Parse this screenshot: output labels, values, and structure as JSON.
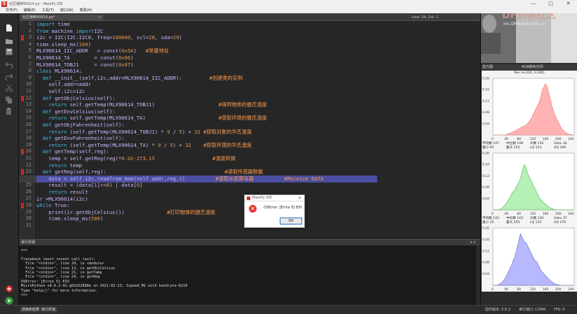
{
  "window": {
    "title": "社区播种90614.py - MaixPy IDE",
    "controls": [
      "—",
      "□",
      "✕"
    ]
  },
  "menu": [
    "文件(F)",
    "编辑(E)",
    "工具(T)",
    "窗口(W)",
    "帮助(H)"
  ],
  "editor_tab": {
    "name": "社区播种90614.py*",
    "info": "Line: 24, Col: 1"
  },
  "line_numbers": [
    "1",
    "2",
    "3",
    "4",
    "5",
    "6",
    "7",
    "8",
    "9",
    "10",
    "11",
    "12",
    "13",
    "14",
    "15",
    "16",
    "17",
    "18",
    "19",
    "20",
    "21",
    "22",
    "23",
    "24",
    "25",
    "26",
    "27",
    "28",
    "29",
    "30",
    "31"
  ],
  "code_lines": [
    [
      [
        "kw",
        "import"
      ],
      [
        "",
        "time"
      ]
    ],
    [
      [
        "kw",
        "from"
      ],
      [
        "",
        "machine"
      ],
      [
        "kw",
        " import"
      ],
      [
        "",
        "I2C"
      ]
    ],
    [
      [
        "",
        "i2c = I2C(I2C.I2C0, freq="
      ],
      [
        "num",
        "100000"
      ],
      [
        "",
        ", scl="
      ],
      [
        "num",
        "28"
      ],
      [
        "",
        ", sda="
      ],
      [
        "num",
        "29"
      ],
      [
        "",
        ")"
      ]
    ],
    [
      [
        "",
        "time.sleep_ms("
      ],
      [
        "num",
        "100"
      ],
      [
        "",
        ")"
      ]
    ],
    [
      [
        "",
        "MLX90614_IIC_ADDR   = const("
      ],
      [
        "num",
        "0x5A"
      ],
      [
        "",
        ")   "
      ],
      [
        "cm",
        "#常量地址"
      ]
    ],
    [
      [
        "",
        "MLX90614_TA        = const("
      ],
      [
        "num",
        "0x06"
      ],
      [
        "",
        ")"
      ]
    ],
    [
      [
        "",
        "MLX90614_TOBJ1     = const("
      ],
      [
        "num",
        "0x07"
      ],
      [
        "",
        ")"
      ]
    ],
    [
      [
        "kw",
        "class"
      ],
      [
        "",
        "MLX90614:"
      ]
    ],
    [
      [
        "",
        "  "
      ],
      [
        "kw",
        "def"
      ],
      [
        "",
        "__init__(self,i2c,addr=MLX90614_IIC_ADDR):         "
      ],
      [
        "cm",
        "#创建类的实例"
      ]
    ],
    [
      [
        "",
        "    self.addr=addr"
      ]
    ],
    [
      [
        "",
        "    self.i2c=i2c"
      ]
    ],
    [
      [
        "",
        "  "
      ],
      [
        "kw",
        "def"
      ],
      [
        "",
        "getObjCelsius(self):"
      ]
    ],
    [
      [
        "",
        "    "
      ],
      [
        "kw",
        "return"
      ],
      [
        "",
        "self.getTemp(MLX90614_TOBJ1)                     "
      ],
      [
        "cm",
        "#得到物体的摄氏温度"
      ]
    ],
    [
      [
        "",
        "  "
      ],
      [
        "kw",
        "def"
      ],
      [
        "",
        "getEnvCelsius(self):"
      ]
    ],
    [
      [
        "",
        "    "
      ],
      [
        "kw",
        "return"
      ],
      [
        "",
        "self.getTemp(MLX90614_TA)                        "
      ],
      [
        "cm",
        "#获取环境的摄氏温度"
      ]
    ],
    [
      [
        "",
        "  "
      ],
      [
        "kw",
        "def"
      ],
      [
        "",
        "getObjFahrenheit(self):"
      ]
    ],
    [
      [
        "",
        "    "
      ],
      [
        "kw",
        "return"
      ],
      [
        "",
        "(self.getTemp(MLX90614_TOBJ1) * "
      ],
      [
        "num",
        "9"
      ],
      [
        "",
        " / "
      ],
      [
        "num",
        "5"
      ],
      [
        "",
        ") + "
      ],
      [
        "num",
        "32"
      ],
      [
        "",
        " "
      ],
      [
        "cm",
        "#获取对象的华氏温度"
      ]
    ],
    [
      [
        "",
        "  "
      ],
      [
        "kw",
        "def"
      ],
      [
        "",
        "getEnvFahrenheit(self):"
      ]
    ],
    [
      [
        "",
        "    "
      ],
      [
        "kw",
        "return"
      ],
      [
        "",
        "(self.getTemp(MLX90614_TA) * "
      ],
      [
        "num",
        "9"
      ],
      [
        "",
        " / "
      ],
      [
        "num",
        "5"
      ],
      [
        "",
        ") + "
      ],
      [
        "num",
        "32"
      ],
      [
        "",
        "    "
      ],
      [
        "cm",
        "#获取环境的华氏温度"
      ]
    ],
    [
      [
        "",
        "  "
      ],
      [
        "kw",
        "def"
      ],
      [
        "",
        "getTemp(self,reg):"
      ]
    ],
    [
      [
        "",
        "    temp = self.getReg(reg)*"
      ],
      [
        "num",
        "0.02"
      ],
      [
        "",
        "-"
      ],
      [
        "num",
        "273.15"
      ],
      [
        "",
        "                   "
      ],
      [
        "cm",
        "#温度转换"
      ]
    ],
    [
      [
        "",
        "    "
      ],
      [
        "kw",
        "return"
      ],
      [
        "",
        "temp"
      ]
    ],
    [
      [
        "",
        "  "
      ],
      [
        "kw",
        "def"
      ],
      [
        "",
        "getReg(self,reg):"
      ],
      [
        "",
        "                                       "
      ],
      [
        "cm",
        "#读取传感器数据"
      ]
    ],
    [
      [
        "",
        "    data = self.i2c.readfrom_mem(self.addr,reg,"
      ],
      [
        "num",
        "3"
      ],
      [
        "",
        ")          "
      ],
      [
        "cm",
        "#读取从机寄存器"
      ],
      [
        "",
        "          "
      ],
      [
        "cm",
        "#Receive DATA"
      ]
    ],
    [
      [
        "",
        "    result = (data["
      ],
      [
        "num",
        "1"
      ],
      [
        "",
        "]<<"
      ],
      [
        "num",
        "8"
      ],
      [
        "",
        ") | data["
      ],
      [
        "num",
        "0"
      ],
      [
        "",
        "]"
      ]
    ],
    [
      [
        "",
        "    "
      ],
      [
        "kw",
        "return"
      ],
      [
        "",
        "result"
      ]
    ],
    [
      [
        "",
        "ir =MLX90614(i2c)"
      ]
    ],
    [
      [
        "kw",
        "while"
      ],
      [
        "",
        "True:"
      ]
    ],
    [
      [
        "",
        "    print(ir.getObjCelsius())              "
      ],
      [
        "cm",
        "#打印物体的摄氏温度"
      ]
    ],
    [
      [
        "",
        "    time.sleep_ms("
      ],
      [
        "num",
        "500"
      ],
      [
        "",
        ")"
      ]
    ],
    [
      [
        "",
        ""
      ]
    ]
  ],
  "dialog": {
    "title": "MaixPy IDE",
    "message": "OSError: [Errno 5] EIO",
    "ok": "OK"
  },
  "terminal": {
    "header": "串行终端",
    "lines": [
      ">>>",
      "",
      "Traceback (most recent call last):",
      "  File \"<stdin>\", line 29, in <module>",
      "  File \"<stdin>\", line 13, in getObjCelsius",
      "  File \"<stdin>\", line 21, in getTemp",
      "  File \"<stdin>\", line 24, in getReg",
      "OSError: [Errno 5] EIO",
      "MicroPython v0.6.2-41-g02d12688e on 2021-03-23; Sipeed_M1 with kendryte-K210",
      "Type \"help()\" for more information.",
      ">>>"
    ]
  },
  "bottom": {
    "tabs": [
      "搜索和结果",
      "串行终端"
    ],
    "fw": "固件版本: 0.6.2",
    "port": "串行端口: COM4",
    "fps": "FPS: 0"
  },
  "right_panel": {
    "watermark": "DF创客社区",
    "url": "mc.DFRobot.com.cn",
    "hist_header_left": "直方图",
    "hist_header_mid": "RGB颜色空间",
    "hist_title": "Res (w:320, h:240)"
  },
  "histograms": [
    {
      "color": "#ffb3b3",
      "stroke": "#e57373",
      "yticks": [
        "0.20",
        "0.16",
        "0.12",
        "0.08",
        "0.04"
      ],
      "xticks": [
        "0",
        "40",
        "80",
        "120",
        "160",
        "200",
        "240"
      ],
      "values": [
        0,
        0,
        0,
        0,
        0,
        0,
        0,
        0,
        0,
        0,
        0.002,
        0.004,
        0.006,
        0.008,
        0.01,
        0.012,
        0.014,
        0.017,
        0.02,
        0.022,
        0.025,
        0.028,
        0.03,
        0.032,
        0.035,
        0.04,
        0.045,
        0.052,
        0.06,
        0.07,
        0.08,
        0.09,
        0.1,
        0.11,
        0.12,
        0.14,
        0.16,
        0.17,
        0.18,
        0.175,
        0.16,
        0.14,
        0.12,
        0.1,
        0.085,
        0.07,
        0.06,
        0.05,
        0.04,
        0.03,
        0.022,
        0.016,
        0.012,
        0.008,
        0.005,
        0.003,
        0.002,
        0.001,
        0,
        0
      ],
      "stats": [
        "平均数  147",
        "中位数  148",
        "众数  132",
        "Sdev  34",
        "最小  92",
        "最大  255",
        "LQ  123",
        "UQ  169"
      ]
    },
    {
      "color": "#b5f0b5",
      "stroke": "#4caf50",
      "yticks": [
        "0.20",
        "0.16",
        "0.12",
        "0.08",
        "0.04"
      ],
      "xticks": [
        "0",
        "40",
        "80",
        "120",
        "160",
        "200",
        "240"
      ],
      "values": [
        0,
        0,
        0,
        0,
        0,
        0.002,
        0.004,
        0.008,
        0.012,
        0.018,
        0.025,
        0.032,
        0.04,
        0.05,
        0.06,
        0.065,
        0.07,
        0.08,
        0.09,
        0.1,
        0.11,
        0.13,
        0.15,
        0.16,
        0.15,
        0.13,
        0.12,
        0.11,
        0.1,
        0.09,
        0.08,
        0.07,
        0.06,
        0.05,
        0.04,
        0.035,
        0.03,
        0.025,
        0.02,
        0.016,
        0.012,
        0.008,
        0.006,
        0.004,
        0.002,
        0.001,
        0,
        0,
        0,
        0,
        0,
        0,
        0,
        0,
        0,
        0,
        0,
        0,
        0,
        0
      ],
      "stats": [
        "平均数  142",
        "中位数  143",
        "众数  130",
        "Sdev  37",
        "最小  25",
        "最大  255",
        "LQ  115",
        "UQ  170"
      ]
    },
    {
      "color": "#b8b8ff",
      "stroke": "#5c6bc0",
      "yticks": [
        "0.20",
        "0.16",
        "0.12",
        "0.08",
        "0.04"
      ],
      "xticks": [
        "0",
        "40",
        "80",
        "120",
        "160",
        "200",
        "240"
      ],
      "values": [
        0,
        0,
        0,
        0,
        0.002,
        0.005,
        0.008,
        0.012,
        0.018,
        0.025,
        0.035,
        0.045,
        0.055,
        0.065,
        0.075,
        0.09,
        0.1,
        0.12,
        0.14,
        0.16,
        0.18,
        0.17,
        0.16,
        0.15,
        0.15,
        0.14,
        0.13,
        0.12,
        0.11,
        0.1,
        0.09,
        0.085,
        0.08,
        0.07,
        0.06,
        0.05,
        0.045,
        0.04,
        0.035,
        0.03,
        0.025,
        0.02,
        0.015,
        0.012,
        0.008,
        0.005,
        0.003,
        0.002,
        0.001,
        0,
        0,
        0,
        0,
        0,
        0,
        0,
        0,
        0,
        0,
        0
      ],
      "stats": []
    }
  ]
}
